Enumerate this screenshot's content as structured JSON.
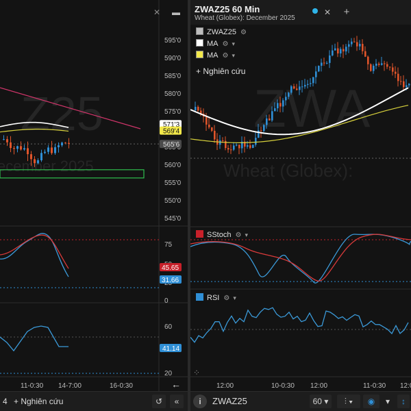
{
  "left": {
    "watermark_symbol": "Z25",
    "watermark_contract": "ecember 2025",
    "price_ticks": [
      "595'0",
      "590'0",
      "585'0",
      "580'0",
      "575'0",
      "570'0",
      "565'0",
      "560'0",
      "555'0",
      "550'0",
      "545'0"
    ],
    "price_tags": [
      {
        "label": "571'3",
        "bg": "#ffffff",
        "fg": "#111111"
      },
      {
        "label": "569'4",
        "bg": "#f2e84a",
        "fg": "#111111"
      },
      {
        "label": "565'6",
        "bg": "#4a4a4a",
        "fg": "#e0e0e0"
      }
    ],
    "stoch_ticks": [
      "75",
      "50",
      "25",
      "0"
    ],
    "stoch_tags": [
      {
        "label": "45.65",
        "bg": "#c8202a",
        "fg": "#ffffff"
      },
      {
        "label": "31.66",
        "bg": "#2f8fd6",
        "fg": "#ffffff"
      }
    ],
    "rsi_ticks": [
      "60",
      "40",
      "20"
    ],
    "rsi_tag": {
      "label": "41.14",
      "bg": "#2f8fd6",
      "fg": "#ffffff"
    },
    "time_ticks": [
      "11-0:30",
      "14-7:00",
      "16-0:30"
    ],
    "toolbar": {
      "count": "4",
      "add_study": "Nghiên cứu",
      "reset": "↺",
      "collapse": "«"
    }
  },
  "right": {
    "title": "ZWAZ25 60 Min",
    "subtitle": "Wheat (Globex): December 2025",
    "legend": [
      {
        "label": "ZWAZ25",
        "color": "#bdbdbd"
      },
      {
        "label": "MA",
        "color": "#ffffff"
      },
      {
        "label": "MA",
        "color": "#f2e84a"
      }
    ],
    "add_study": "Nghiên cứu",
    "watermark_symbol": "ZWA",
    "watermark_contract": "Wheat (Globex):",
    "sstoch_label": "SStoch",
    "rsi_label": "RSI",
    "time_ticks": [
      "12:00",
      "10-0:30",
      "12:00",
      "11-0:30",
      "12:00"
    ],
    "toolbar": {
      "info": "i",
      "symbol": "ZWAZ25",
      "interval": "60"
    },
    "colors": {
      "up": "#2f8fd6",
      "down": "#e0552b",
      "ma_white": "#ffffff",
      "ma_yellow": "#d8d23c",
      "trend": "#d0356a",
      "stoch_k": "#3b9ad9",
      "stoch_d": "#d83a3a",
      "rsi": "#3b9ad9"
    }
  }
}
